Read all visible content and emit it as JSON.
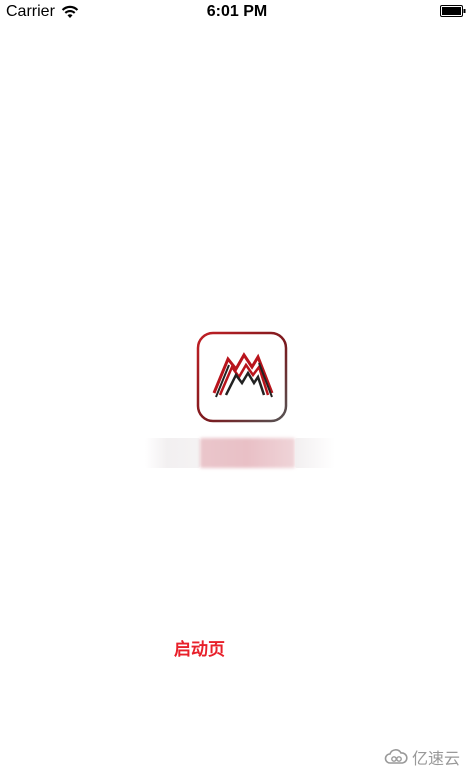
{
  "status_bar": {
    "carrier": "Carrier",
    "time": "6:01 PM",
    "icons": [
      "wifi-icon",
      "battery-icon"
    ]
  },
  "logo": {
    "icon": "app-logo-m-icon",
    "colors": {
      "primary": "#b8141c",
      "secondary": "#222222",
      "border_top": "#c21f24",
      "border_bottom": "#555555"
    }
  },
  "launch_label": "启动页",
  "watermark": {
    "icon": "cloud-icon",
    "text": "亿速云"
  },
  "colors": {
    "accent": "#e8202a",
    "background": "#ffffff"
  }
}
